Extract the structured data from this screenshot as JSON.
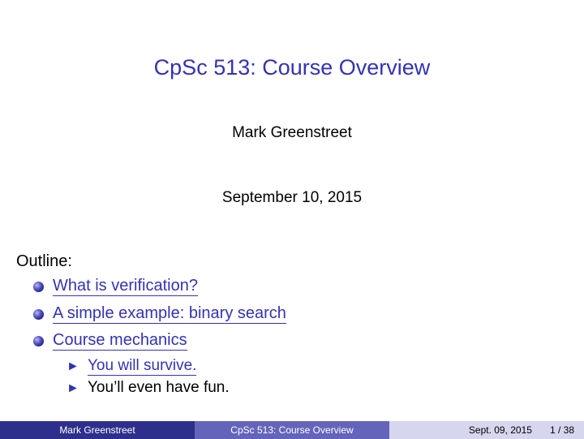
{
  "slide": {
    "title": "CpSc 513: Course Overview",
    "author": "Mark Greenstreet",
    "date": "September 10, 2015"
  },
  "outline": {
    "label": "Outline:",
    "items": [
      {
        "label": "What is verification?",
        "link": true
      },
      {
        "label": "A simple example: binary search",
        "link": true
      },
      {
        "label": "Course mechanics",
        "link": true
      }
    ],
    "subitems": [
      {
        "label": "You will survive.",
        "link": true
      },
      {
        "label": "You’ll even have fun.",
        "link": false
      }
    ]
  },
  "footer": {
    "author": "Mark Greenstreet",
    "title": "CpSc 513: Course Overview",
    "date": "Sept. 09, 2015",
    "page": "1 / 38"
  },
  "colors": {
    "accent": "#3333b2",
    "footer_dark": "#2e2e8c",
    "footer_mid": "#6464ba",
    "footer_light": "#d6d6ee"
  }
}
